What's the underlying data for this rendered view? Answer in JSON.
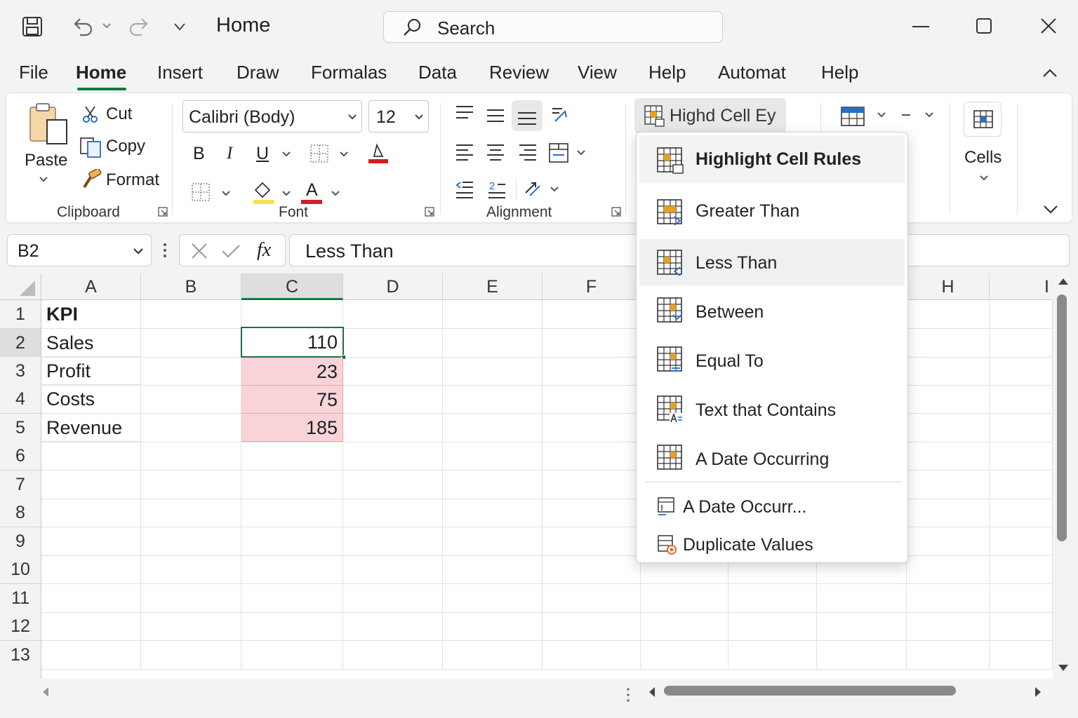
{
  "title_bar": {
    "title": "Home",
    "search_placeholder": "Search"
  },
  "tabs": [
    "File",
    "Home",
    "Insert",
    "Draw",
    "Formalas",
    "Data",
    "Review",
    "View",
    "Help",
    "Automat",
    "Help"
  ],
  "active_tab": "Home",
  "ribbon": {
    "clipboard": {
      "paste": "Paste",
      "cut": "Cut",
      "copy": "Copy",
      "format": "Format",
      "group_label": "Clipboard"
    },
    "font": {
      "font_name": "Calibri (Body)",
      "font_size": "12",
      "bold": "B",
      "italic": "I",
      "underline": "U",
      "font_color_glyph": "A",
      "group_label": "Font",
      "fill_color": "#ffe14d",
      "text_color": "#d11f1f"
    },
    "alignment": {
      "group_label": "Alignment"
    },
    "styles": {
      "button_label": "Highd Cell Ey"
    },
    "cells": {
      "label": "Cells"
    }
  },
  "formula_bar": {
    "name_box": "B2",
    "fx": "fx",
    "formula": "Less Than"
  },
  "sheet": {
    "columns": [
      "A",
      "B",
      "C",
      "D",
      "E",
      "F",
      "H",
      "I"
    ],
    "rows": [
      "1",
      "2",
      "3",
      "4",
      "5",
      "6",
      "7",
      "8",
      "9",
      "10",
      "11",
      "12",
      "13"
    ],
    "cells": {
      "A1": "KPI",
      "A2": "Sales",
      "A3": "Profit",
      "A4": "Costs",
      "A5": "Revenue",
      "C2": "110",
      "C3": "23",
      "C4": "75",
      "C5": "185"
    },
    "highlight_color": "#f8d4d8",
    "accent_color": "#107c41"
  },
  "dropdown_menu": {
    "header": "Highlight Cell Rules",
    "items": [
      "Greater Than",
      "Less Than",
      "Between",
      "Equal To",
      "Text that Contains",
      "A Date Occurring"
    ],
    "hovered_item": "Less Than",
    "extra_items": [
      "A Date Occurr...",
      "Duplicate Values"
    ]
  }
}
